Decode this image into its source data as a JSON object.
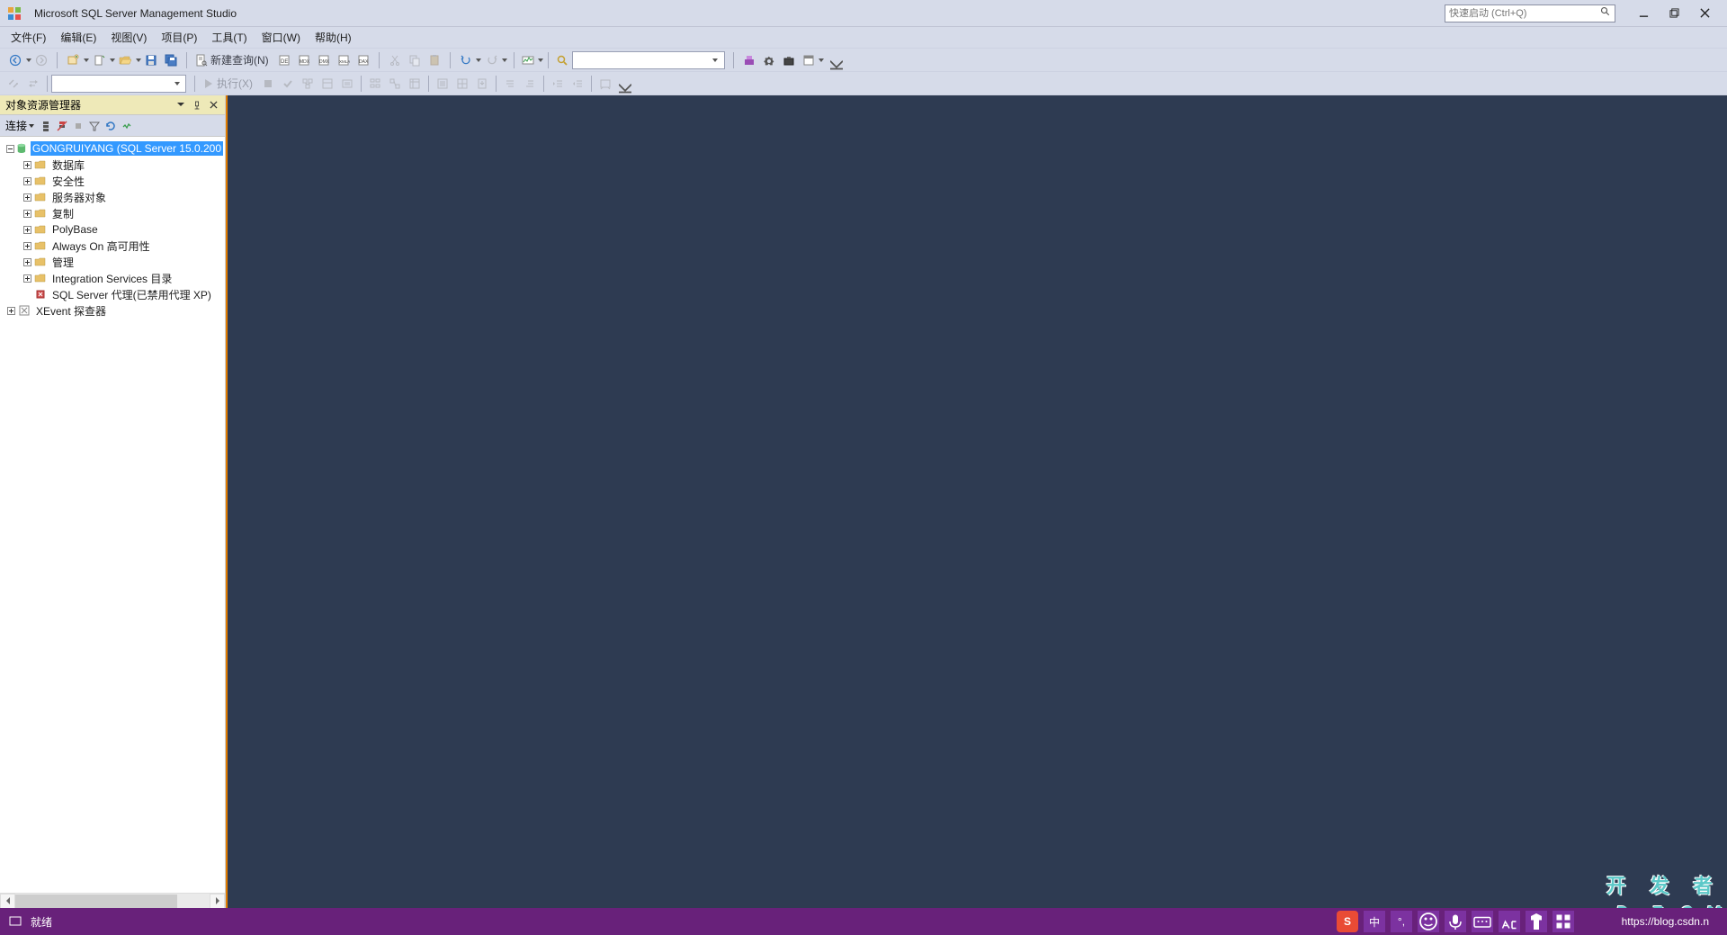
{
  "titlebar": {
    "title": "Microsoft SQL Server Management Studio",
    "quick_launch_placeholder": "快速启动 (Ctrl+Q)"
  },
  "menubar": {
    "items": [
      {
        "label": "文件(F)"
      },
      {
        "label": "编辑(E)"
      },
      {
        "label": "视图(V)"
      },
      {
        "label": "项目(P)"
      },
      {
        "label": "工具(T)"
      },
      {
        "label": "窗口(W)"
      },
      {
        "label": "帮助(H)"
      }
    ]
  },
  "toolbar1": {
    "new_query": "新建查询(N)"
  },
  "toolbar2": {
    "execute": "执行(X)"
  },
  "sidebar": {
    "title": "对象资源管理器",
    "connect_label": "连接",
    "server_node": "GONGRUIYANG (SQL Server 15.0.200",
    "nodes": [
      {
        "label": "数据库",
        "icon": "folder",
        "expandable": true
      },
      {
        "label": "安全性",
        "icon": "folder",
        "expandable": true
      },
      {
        "label": "服务器对象",
        "icon": "folder",
        "expandable": true
      },
      {
        "label": "复制",
        "icon": "folder",
        "expandable": true
      },
      {
        "label": "PolyBase",
        "icon": "folder",
        "expandable": true
      },
      {
        "label": "Always On 高可用性",
        "icon": "folder",
        "expandable": true
      },
      {
        "label": "管理",
        "icon": "folder",
        "expandable": true
      },
      {
        "label": "Integration Services 目录",
        "icon": "folder",
        "expandable": true
      },
      {
        "label": "SQL Server 代理(已禁用代理 XP)",
        "icon": "agent",
        "expandable": false
      },
      {
        "label": "XEvent 探查器",
        "icon": "xevent",
        "expandable": true
      }
    ]
  },
  "statusbar": {
    "ready": "就绪",
    "url": "https://blog.csdn.n"
  },
  "ime": {
    "sogou": "S",
    "zhong": "中",
    "punct": "°,"
  },
  "watermark": {
    "top": "开 发 者",
    "bottom": "DevZe.CoM"
  }
}
